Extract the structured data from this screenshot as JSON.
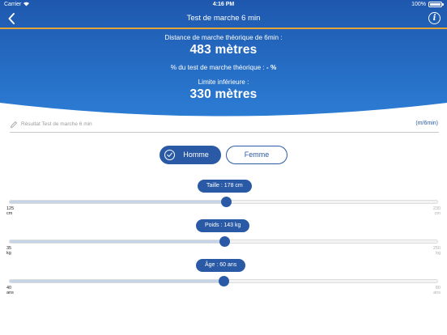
{
  "status_bar": {
    "carrier": "Carrier",
    "time": "4:16 PM",
    "battery": "100%"
  },
  "navbar": {
    "title": "Test de marche 6 min",
    "info_glyph": "i"
  },
  "colors": {
    "accent": "#2a5aa6",
    "navbar_line": "#e3a43a",
    "hero_top": "#1f5bb0",
    "hero_bottom": "#2e7fd6"
  },
  "summary": {
    "theoretical_label": "Distance de marche théorique de 6min :",
    "theoretical_value": "483 mètres",
    "percent_label": "% du test de marche théorique :",
    "percent_value": "- %",
    "lower_label": "Limite inférieure :",
    "lower_value": "330 mètres"
  },
  "result": {
    "placeholder": "Résultat Test de marche 6 min",
    "value": "",
    "unit": "(m/6min)",
    "icon": "pencil-icon"
  },
  "sex": {
    "options": [
      "Homme",
      "Femme"
    ],
    "selected": "Homme",
    "selected_icon": "check-circle-icon"
  },
  "sliders": {
    "height": {
      "label": "Taille : 178 cm",
      "value": 178,
      "min": 125,
      "max": 230,
      "min_label": "125",
      "max_label": "230",
      "unit": "cm"
    },
    "weight": {
      "label": "Poids : 143 kg",
      "value": 143,
      "min": 35,
      "max": 250,
      "min_label": "35",
      "max_label": "250",
      "unit": "kg"
    },
    "age": {
      "label": "Âge : 60 ans",
      "value": 60,
      "min": 40,
      "max": 80,
      "min_label": "40",
      "max_label": "80",
      "unit": "ans"
    }
  }
}
